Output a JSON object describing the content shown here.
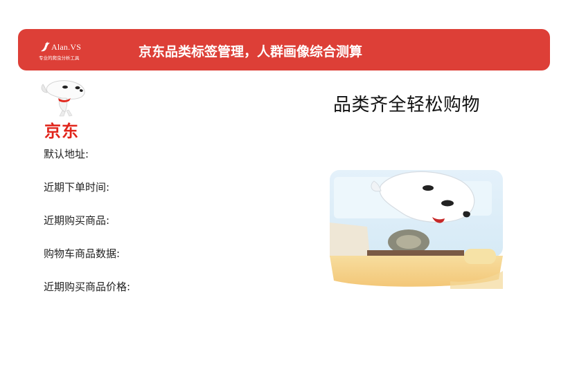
{
  "header": {
    "brand_name": "Alan.VS",
    "brand_tagline": "专业的爬虫分析工具",
    "title": "京东品类标签管理，人群画像综合测算"
  },
  "logo": {
    "text": "京东",
    "icon": "jd-dog-mascot-icon"
  },
  "fields": [
    {
      "label": "默认地址:"
    },
    {
      "label": "近期下单时间:"
    },
    {
      "label": "近期购买商品:"
    },
    {
      "label": "购物车商品数据:"
    },
    {
      "label": "近期购买商品价格:"
    }
  ],
  "headline": "品类齐全轻松购物",
  "illustration": {
    "icon": "jd-mascot-driving-illustration"
  },
  "colors": {
    "banner": "#dd3f37",
    "jd_red": "#e1251b"
  }
}
